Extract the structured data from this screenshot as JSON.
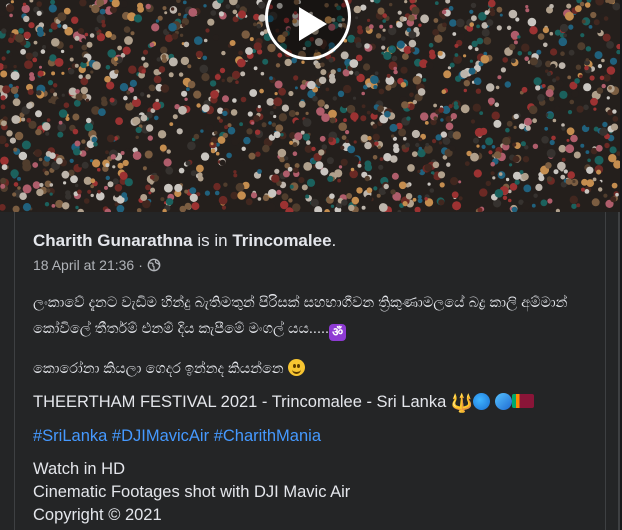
{
  "post": {
    "author": "Charith Gunarathna",
    "is_in": " is in ",
    "location": "Trincomalee",
    "period": ".",
    "date": "18 April at 21:36",
    "dot": "·",
    "privacy_icon": "globe-icon",
    "line1": "ලංකාවේ දැනට වැඩිම හින්දු බැතිමතුන් පිරිසක් සහභාගීවන ත්‍රිකුණාමලයේ බද්‍ර කාලි අම්මාන් කෝවිලේ තීර්තම් එනම් දිය කැපීමේ මංගල් යය.....",
    "line2": "කොරෝනා කියලා ගෙදර ඉන්නද කියන්නෙ",
    "line3": "THEERTHAM FESTIVAL 2021 - Trincomalee - Sri Lanka",
    "hashtags": [
      "#SriLanka",
      "#DJIMavicAir",
      "#CharithMania"
    ],
    "line5a": "Watch in HD",
    "line5b": "Cinematic Footages shot with DJI Mavic Air",
    "line5c": "Copyright © 2021"
  },
  "video": {
    "play_icon": "play-icon"
  }
}
